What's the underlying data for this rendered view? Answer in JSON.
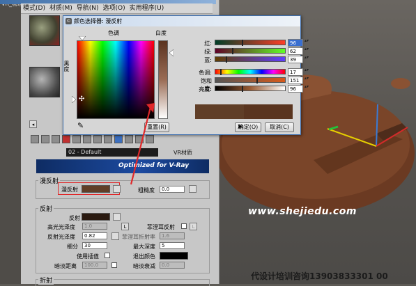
{
  "app": {
    "window_fragment": "VR_物理整",
    "menu": [
      "模式(D)",
      "材质(M)",
      "导航(N)",
      "选项(O)",
      "实用程序(U)"
    ]
  },
  "material_editor": {
    "material_name": "02 - Default",
    "material_type": "VR材质",
    "banner": "Optimized for V-Ray",
    "diffuse_group": {
      "title": "漫反射",
      "diffuse_label": "漫反射",
      "roughness_label": "粗糙度",
      "roughness_value": "0.0"
    },
    "reflection_group": {
      "title": "反射",
      "reflect_label": "反射",
      "highlight_gloss_label": "高光光泽度",
      "highlight_gloss_value": "1.0",
      "highlight_lock": "L",
      "fresnel_label": "菲涅耳反射",
      "fresnel_lock": "L",
      "refl_gloss_label": "反射光泽度",
      "refl_gloss_value": "0.82",
      "fresnel_ior_label": "菲涅耳折射率",
      "fresnel_ior_value": "1.6",
      "subdivs_label": "细分",
      "subdivs_value": "30",
      "max_depth_label": "最大深度",
      "max_depth_value": "5",
      "use_interp_label": "使用插值",
      "exit_color_label": "退出颜色",
      "dim_distance_label": "暗淡距离",
      "dim_distance_value": "100.0",
      "dim_falloff_label": "暗淡衰减",
      "dim_falloff_value": "0.0"
    },
    "refraction_group_title": "折射"
  },
  "color_dialog": {
    "title": "颜色选择器: 漫反射",
    "hue_header": "色调",
    "whiteness_header": "白度",
    "blackness_label": "黑度",
    "sliders": [
      {
        "label": "红:",
        "value": "96",
        "fraction": 0.376
      },
      {
        "label": "绿:",
        "value": "62",
        "fraction": 0.243
      },
      {
        "label": "蓝:",
        "value": "39",
        "fraction": 0.153
      },
      {
        "label": "色调:",
        "value": "17",
        "fraction": 0.067
      },
      {
        "label": "饱和度:",
        "value": "151",
        "fraction": 0.592
      },
      {
        "label": "亮度:",
        "value": "96",
        "fraction": 0.376
      }
    ],
    "reset_button": "重置(R)",
    "ok_button": "确定(O)",
    "cancel_button": "取消(C)",
    "current_color": "#603e27",
    "previous_color": "#5a3520"
  },
  "watermark": "www.shejiedu.com",
  "footer_caption": "代设计培训咨询13903833301  00",
  "colors": {
    "diffuse_swatch": "#603e27",
    "reflect_swatch": "#2a1a10",
    "object_brown": "#6b3a22",
    "annotation_red": "#e0282a"
  }
}
